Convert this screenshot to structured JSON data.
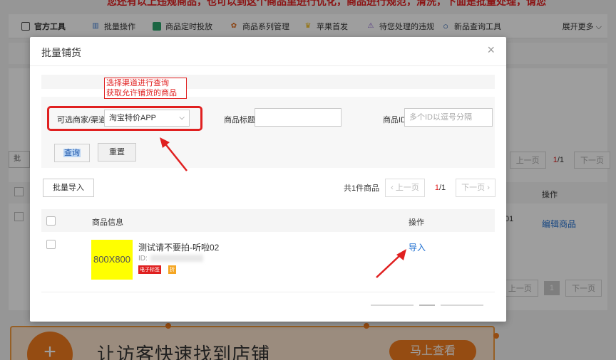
{
  "background": {
    "top_banner_text": "您还有以上违规商品，也可以到这个商品里进行优化，商品进行规范，清洗，下面是批量处理，请您",
    "toolbar": [
      {
        "label": "官方工具",
        "icon": "edit-icon"
      },
      {
        "label": "批量操作",
        "icon": "bars-icon"
      },
      {
        "label": "商品定时投放",
        "icon": "timer-icon"
      },
      {
        "label": "商品系列管理",
        "icon": "flower-icon"
      },
      {
        "label": "苹果首发",
        "icon": "crown-icon"
      },
      {
        "label": "待您处理的违规",
        "icon": "warning-icon"
      },
      {
        "label": "新品查询工具",
        "icon": "search-icon"
      }
    ],
    "toolbar_more": "展开更多",
    "pager": {
      "prev": "上一页",
      "page": "1",
      "total": "/1",
      "next": "下一页"
    },
    "table_op_header": "操作",
    "edit_link": "编辑商品",
    "row_fragment": "01",
    "pager2": {
      "prev": "上一页",
      "current": "1",
      "next": "下一页"
    },
    "left_btn": "批",
    "banner": {
      "title": "让访客快速找到店铺",
      "button": "马上查看",
      "plus": "+"
    }
  },
  "modal": {
    "title": "批量铺货",
    "close": "×",
    "annotation_note": [
      "选择渠道进行查询",
      "获取允许铺货的商品"
    ],
    "filters": {
      "channel_label": "可选商家/渠道",
      "channel_value": "淘宝特价APP",
      "title_label": "商品标题",
      "title_value": "",
      "id_label": "商品ID",
      "id_placeholder": "多个ID以逗号分隔"
    },
    "query_button": "查询",
    "reset_button": "重置",
    "batch_import_button": "批量导入",
    "total_text": "共1件商品",
    "pager": {
      "prev": "上一页",
      "page": "1",
      "total": "/1",
      "next": "下一页"
    },
    "table": {
      "columns": [
        "商品信息",
        "操作"
      ],
      "rows": [
        {
          "thumbnail": "800X800",
          "name": "测试请不要拍-听啦02",
          "id_label": "ID:",
          "tags": [
            "电子标签",
            "折"
          ],
          "action": "导入"
        }
      ]
    }
  },
  "colors": {
    "accent_red": "#e02020",
    "link_blue": "#1f6fd1",
    "banner_orange": "#f07b1e"
  }
}
